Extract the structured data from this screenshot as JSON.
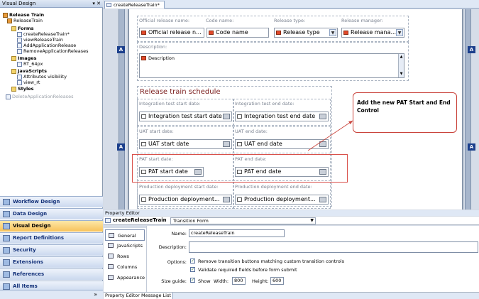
{
  "left_panel": {
    "title": "Visual Design",
    "title_buttons": "▾ ✕",
    "tree": [
      {
        "label": "Release Train",
        "bold": true,
        "icon": "app-icon"
      },
      {
        "label": "ReleaseTrain",
        "bold": false,
        "icon": "app-icon"
      },
      {
        "label": "Forms",
        "bold": true,
        "icon": "folder-icon"
      },
      {
        "label": "createReleaseTrain*",
        "bold": false,
        "icon": "form-icon"
      },
      {
        "label": "viewReleaseTrain",
        "bold": false,
        "icon": "form-icon"
      },
      {
        "label": "AddApplicationRelease",
        "bold": false,
        "icon": "form-icon"
      },
      {
        "label": "RemoveApplicationReleases",
        "bold": false,
        "icon": "form-icon"
      },
      {
        "label": "Images",
        "bold": true,
        "icon": "folder-icon"
      },
      {
        "label": "RT_64px",
        "bold": false,
        "icon": "image-icon"
      },
      {
        "label": "JavaScripts",
        "bold": true,
        "icon": "folder-icon"
      },
      {
        "label": "Attributes visibility",
        "bold": false,
        "icon": "script-icon"
      },
      {
        "label": "view_rt",
        "bold": false,
        "icon": "script-icon"
      },
      {
        "label": "Styles",
        "bold": true,
        "icon": "folder-icon"
      },
      {
        "label": "DeleteApplicationReleases",
        "bold": false,
        "icon": "form-icon",
        "gray": true
      }
    ],
    "nav": [
      {
        "label": "Workflow Design",
        "icon": "workflow-icon"
      },
      {
        "label": "Data Design",
        "icon": "data-icon"
      },
      {
        "label": "Visual Design",
        "icon": "visual-design-icon",
        "active": true
      },
      {
        "label": "Report Definitions",
        "icon": "report-icon"
      },
      {
        "label": "Security",
        "icon": "security-icon"
      },
      {
        "label": "Extensions",
        "icon": "extensions-icon"
      },
      {
        "label": "References",
        "icon": "references-icon"
      },
      {
        "label": "All Items",
        "icon": "all-items-icon"
      }
    ],
    "expand_glyph": "»"
  },
  "editor": {
    "tab_label": "createReleaseTrain*",
    "anchor_label": "A",
    "header_fields": {
      "official_release_name_label": "Official release name:",
      "official_release_name_value": "Official release n...",
      "code_name_label": "Code name:",
      "code_name_value": "Code name",
      "release_type_label": "Release type:",
      "release_type_value": "Release type",
      "release_manager_label": "Release manager:",
      "release_manager_value": "Release mana...",
      "description_label": "Description:",
      "description_value": "Description"
    },
    "schedule": {
      "title": "Release train schedule",
      "rows": [
        {
          "start_label": "Integration test start date:",
          "start_value": "Integration test start date",
          "end_label": "Integration test end date:",
          "end_value": "Integration test end date"
        },
        {
          "start_label": "UAT start date:",
          "start_value": "UAT start date",
          "end_label": "UAT end date:",
          "end_value": "UAT end date"
        },
        {
          "start_label": "PAT start date:",
          "start_value": "PAT start date",
          "end_label": "PAT end date:",
          "end_value": "PAT end date"
        },
        {
          "start_label": "Production deployment start date:",
          "start_value": "Production deployment...",
          "end_label": "Production deployment end date:",
          "end_value": "Production deployment..."
        }
      ]
    },
    "annotation": "Add the new PAT Start and End Control"
  },
  "property_editor": {
    "title": "Property Editor",
    "object_name": "createReleaseTrain",
    "object_type": "Transition Form",
    "tabs": [
      {
        "label": "General",
        "active": true,
        "icon": "general-icon"
      },
      {
        "label": "JavaScripts",
        "icon": "javascripts-icon"
      },
      {
        "label": "Rows",
        "icon": "rows-icon"
      },
      {
        "label": "Columns",
        "icon": "columns-icon"
      },
      {
        "label": "Appearance",
        "icon": "appearance-icon"
      }
    ],
    "name_label": "Name:",
    "name_value": "createReleaseTrain",
    "description_label": "Description:",
    "options_label": "Options:",
    "option1": "Remove transition buttons matching custom transition controls",
    "option2": "Validate required fields before form submit",
    "size_guide_label": "Size guide:",
    "show_label": "Show",
    "width_label": "Width:",
    "width_value": "800",
    "height_label": "Height:",
    "height_value": "600",
    "bottom_tabs": [
      "Property Editor",
      "Message List"
    ]
  },
  "colors": {
    "accent": "#1b3f8c",
    "annotation_border": "#c9423a",
    "nav_active": "#f7c25a"
  }
}
